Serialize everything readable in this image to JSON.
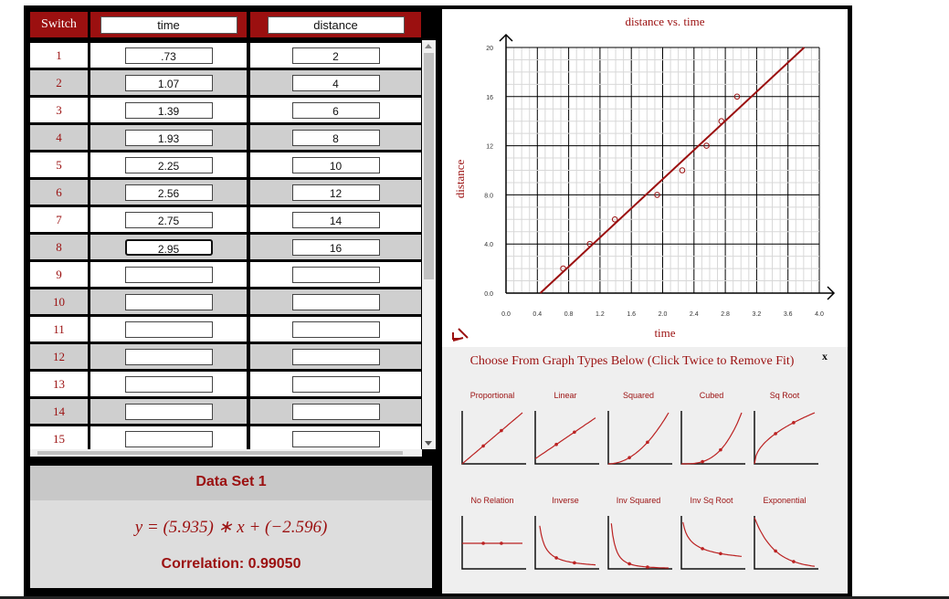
{
  "table": {
    "switch_label": "Switch",
    "col1_header": "time",
    "col2_header": "distance",
    "rows": [
      {
        "n": "1",
        "time": ".73",
        "distance": "2"
      },
      {
        "n": "2",
        "time": "1.07",
        "distance": "4"
      },
      {
        "n": "3",
        "time": "1.39",
        "distance": "6"
      },
      {
        "n": "4",
        "time": "1.93",
        "distance": "8"
      },
      {
        "n": "5",
        "time": "2.25",
        "distance": "10"
      },
      {
        "n": "6",
        "time": "2.56",
        "distance": "12"
      },
      {
        "n": "7",
        "time": "2.75",
        "distance": "14"
      },
      {
        "n": "8",
        "time": "2.95",
        "distance": "16"
      },
      {
        "n": "9",
        "time": "",
        "distance": ""
      },
      {
        "n": "10",
        "time": "",
        "distance": ""
      },
      {
        "n": "11",
        "time": "",
        "distance": ""
      },
      {
        "n": "12",
        "time": "",
        "distance": ""
      },
      {
        "n": "13",
        "time": "",
        "distance": ""
      },
      {
        "n": "14",
        "time": "",
        "distance": ""
      },
      {
        "n": "15",
        "time": "",
        "distance": ""
      }
    ]
  },
  "dataset": {
    "title": "Data Set 1",
    "equation": "y = (5.935) ∗ x + (−2.596)",
    "correlation": "Correlation: 0.99050"
  },
  "chart_data": {
    "type": "scatter",
    "title": "distance vs. time",
    "xlabel": "time",
    "ylabel": "distance",
    "xlim": [
      0,
      4.0
    ],
    "ylim": [
      0,
      20
    ],
    "xticks": [
      "0.0",
      "0.4",
      "0.8",
      "1.2",
      "1.6",
      "2.0",
      "2.4",
      "2.8",
      "3.2",
      "3.6",
      "4.0"
    ],
    "yticks": [
      "0.0",
      "4.0",
      "8.0",
      "12",
      "16",
      "20"
    ],
    "points": [
      {
        "x": 0.73,
        "y": 2
      },
      {
        "x": 1.07,
        "y": 4
      },
      {
        "x": 1.39,
        "y": 6
      },
      {
        "x": 1.93,
        "y": 8
      },
      {
        "x": 2.25,
        "y": 10
      },
      {
        "x": 2.56,
        "y": 12
      },
      {
        "x": 2.75,
        "y": 14
      },
      {
        "x": 2.95,
        "y": 16
      }
    ],
    "fit": {
      "type": "linear",
      "slope": 5.935,
      "intercept": -2.596
    },
    "grid": true,
    "color": "#9b1010"
  },
  "chooser": {
    "title": "Choose From Graph Types Below (Click Twice to Remove Fit)",
    "close": "x",
    "types": [
      "Proportional",
      "Linear",
      "Squared",
      "Cubed",
      "Sq Root",
      "No Relation",
      "Inverse",
      "Inv Squared",
      "Inv Sq Root",
      "Exponential"
    ]
  }
}
